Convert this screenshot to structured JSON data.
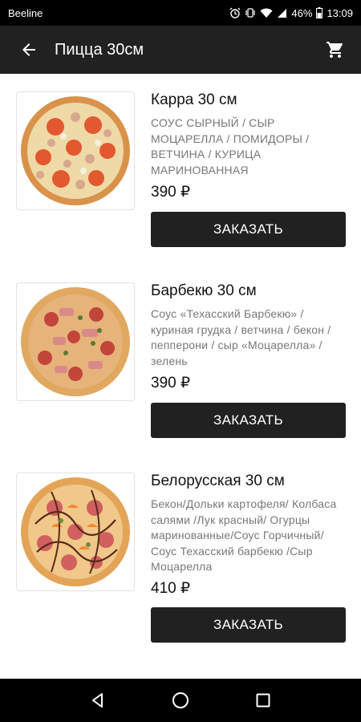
{
  "status_bar": {
    "carrier": "Beeline",
    "battery": "46%",
    "time": "13:09"
  },
  "app_bar": {
    "title": "Пицца 30см",
    "back_icon": "arrow-back-icon",
    "cart_icon": "shopping-cart-icon"
  },
  "items": [
    {
      "name": "Карра 30 см",
      "description": "СОУС СЫРНЫЙ / СЫР МОЦАРЕЛЛА  / ПОМИДОРЫ / ВЕТЧИНА / КУРИЦА МАРИНОВАННАЯ",
      "price": "390 ₽",
      "button": "ЗАКАЗАТЬ"
    },
    {
      "name": "Барбекю 30 см",
      "description": "Соус «Техасский Барбекю» / куриная грудка / ветчина / бекон / пепперони / сыр «Моцарелла» / зелень",
      "price": "390 ₽",
      "button": "ЗАКАЗАТЬ"
    },
    {
      "name": "Белорусская 30 см",
      "description": "Бекон/Дольки картофеля/ Колбаса салями /Лук красный/ Огурцы маринованные/Соус Горчичный/ Соус  Техасский барбекю /Сыр  Моцарелла",
      "price": "410 ₽",
      "button": "ЗАКАЗАТЬ"
    }
  ],
  "nav_bar": {
    "back_icon": "nav-back-icon",
    "home_icon": "nav-home-icon",
    "recents_icon": "nav-recents-icon"
  }
}
